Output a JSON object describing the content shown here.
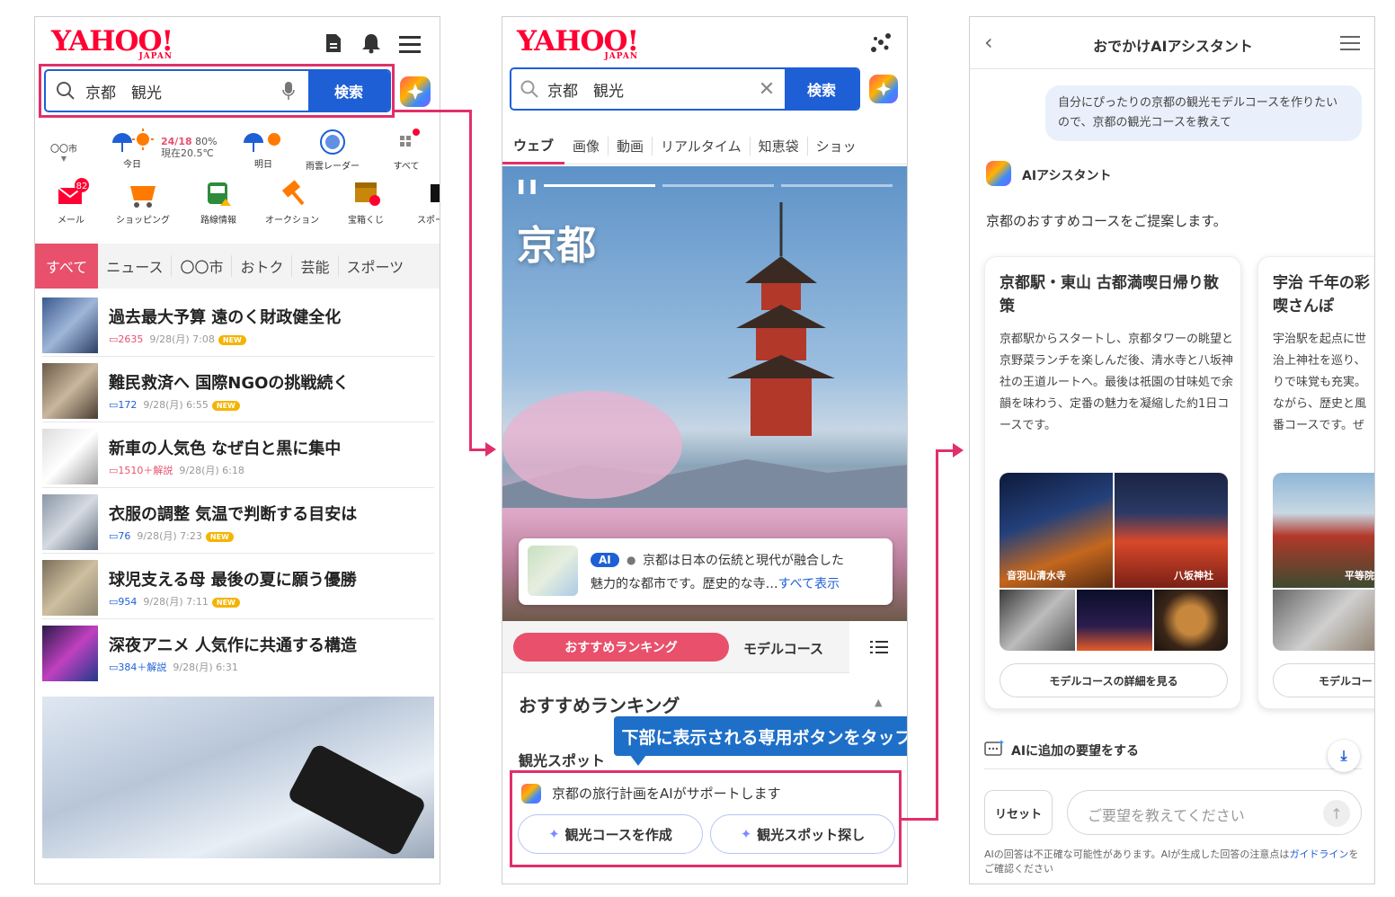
{
  "screen1": {
    "logo": "YAHOO!",
    "logo_sub": "JAPAN",
    "search_query": "京都　観光",
    "search_button": "検索",
    "weather": {
      "city": "〇〇市",
      "temp": "24/18",
      "rain": "80%",
      "now": "現在20.5℃",
      "today": "今日",
      "tomorrow": "明日",
      "radar": "雨雲レーダー",
      "all": "すべて"
    },
    "services": [
      {
        "label": "メール",
        "badge": "82"
      },
      {
        "label": "ショッピング"
      },
      {
        "label": "路線情報"
      },
      {
        "label": "オークション"
      },
      {
        "label": "宝箱くじ"
      },
      {
        "label": "スポー"
      }
    ],
    "tabs": [
      "すべて",
      "ニュース",
      "〇〇市",
      "おトク",
      "芸能",
      "スポーツ"
    ],
    "news": [
      {
        "title": "過去最大予算 遠のく財政健全化",
        "comments": "2635",
        "date": "9/28(月) 7:08",
        "new": "NEW"
      },
      {
        "title": "難民救済へ 国際NGOの挑戦続く",
        "comments": "172",
        "date": "9/28(月) 6:55",
        "new": "NEW"
      },
      {
        "title": "新車の人気色 なぜ白と黒に集中",
        "comments": "1510＋解説",
        "date": "9/28(月) 6:18",
        "new": ""
      },
      {
        "title": "衣服の調整 気温で判断する目安は",
        "comments": "76",
        "date": "9/28(月) 7:23",
        "new": "NEW"
      },
      {
        "title": "球児支える母 最後の夏に願う優勝",
        "comments": "954",
        "date": "9/28(月) 7:11",
        "new": "NEW"
      },
      {
        "title": "深夜アニメ 人気作に共通する構造",
        "comments": "384＋解説",
        "date": "9/28(月) 6:31",
        "new": ""
      }
    ]
  },
  "screen2": {
    "logo": "YAHOO!",
    "logo_sub": "JAPAN",
    "search_query": "京都　観光",
    "search_button": "検索",
    "tabs": [
      "ウェブ",
      "画像",
      "動画",
      "リアルタイム",
      "知恵袋",
      "ショッ"
    ],
    "hero_title": "京都",
    "ai_badge": "AI",
    "ai_summary_1": "京都は日本の伝統と現代が融合した",
    "ai_summary_2": "魅力的な都市です。歴史的な寺…",
    "ai_more": "すべて表示",
    "tab_ranking": "おすすめランキング",
    "tab_model": "モデルコース",
    "section_title": "おすすめランキング",
    "section_sub": "観光スポット",
    "callout": "下部に表示される専用ボタンをタップ",
    "support_text": "京都の旅行計画をAIがサポートします",
    "btn_course": "観光コースを作成",
    "btn_spot": "観光スポット探し"
  },
  "screen3": {
    "header_title": "おでかけAIアシスタント",
    "user_message": "自分にぴったりの京都の観光モデルコースを作りたいので、京都の観光コースを教えて",
    "assistant_name": "AIアシスタント",
    "assistant_intro": "京都のおすすめコースをご提案します。",
    "cards": [
      {
        "title": "京都駅・東山 古都満喫日帰り散策",
        "body": "京都駅からスタートし、京都タワーの眺望と京野菜ランチを楽しんだ後、清水寺と八坂神社の王道ルートへ。最後は祇園の甘味処で余韻を味わう、定番の魅力を凝縮した約1日コースです。",
        "photo_labels": [
          "音羽山清水寺",
          "八坂神社"
        ],
        "button": "モデルコースの詳細を見る"
      },
      {
        "title": "宇治 千年の彩",
        "title2": "喫さんぽ",
        "body_lines": [
          "宇治駅を起点に世",
          "治上神社を巡り、",
          "りで味覚も充実。",
          "ながら、歴史と風",
          "番コースです。ぜ"
        ],
        "photo_label": "平等院",
        "button": "モデルコー"
      }
    ],
    "add_request": "AIに追加の要望をする",
    "reset": "リセット",
    "input_placeholder": "ご要望を教えてください",
    "disclaimer_1": "AIの回答は不正確な可能性があります。AIが生成した回答の注意点は",
    "disclaimer_link": "ガイドライン",
    "disclaimer_2": "をご確認ください"
  },
  "colors": {
    "accent": "#e0306b",
    "blue": "#1e5fd6",
    "red": "#ff0033"
  }
}
